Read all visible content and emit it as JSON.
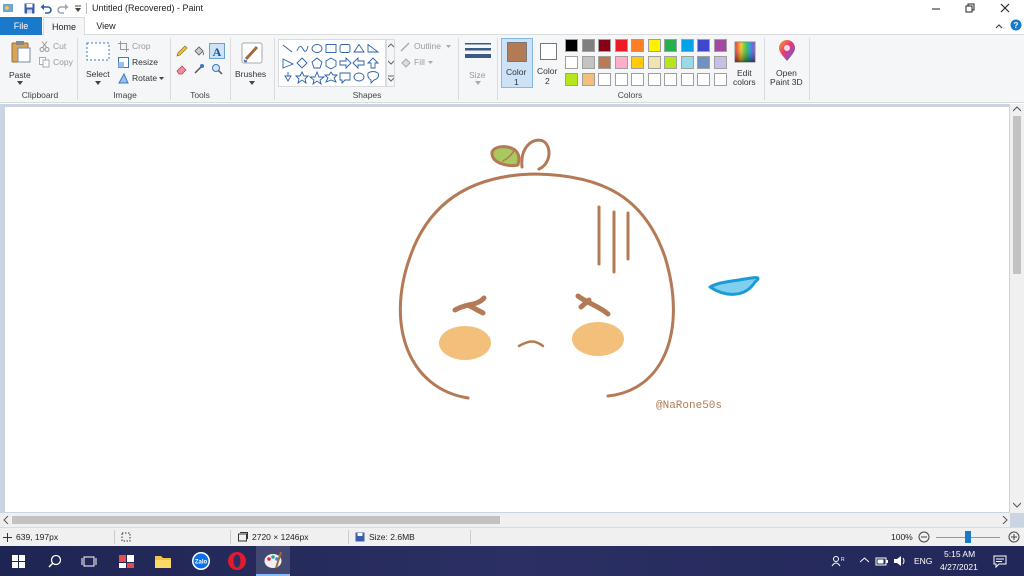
{
  "window": {
    "title": "Untitled (Recovered) - Paint"
  },
  "tabs": {
    "file": "File",
    "home": "Home",
    "view": "View"
  },
  "clipboard": {
    "paste": "Paste",
    "cut": "Cut",
    "copy": "Copy",
    "group": "Clipboard"
  },
  "image": {
    "select": "Select",
    "crop": "Crop",
    "resize": "Resize",
    "rotate": "Rotate",
    "group": "Image"
  },
  "tools": {
    "group": "Tools"
  },
  "brushes": {
    "label": "Brushes"
  },
  "shapes": {
    "outline": "Outline",
    "fill": "Fill",
    "group": "Shapes"
  },
  "size": {
    "label": "Size"
  },
  "colors": {
    "color1": "Color",
    "color1_num": "1",
    "color2": "Color",
    "color2_num": "2",
    "edit1": "Edit",
    "edit2": "colors",
    "group": "Colors",
    "color1_value": "#b47a55",
    "color2_value": "#ffffff",
    "row1": [
      "#000000",
      "#7f7f7f",
      "#880015",
      "#ed1c24",
      "#ff7f27",
      "#fff200",
      "#22b14c",
      "#00a2e8",
      "#3f48cc",
      "#a349a4"
    ],
    "row2": [
      "#ffffff",
      "#c3c3c3",
      "#b97a57",
      "#ffaec9",
      "#ffc90e",
      "#efe4b0",
      "#b5e61d",
      "#99d9ea",
      "#7092be",
      "#c8bfe7"
    ],
    "row3": [
      "#b5e61d",
      "#f2c07a",
      "#ffffff",
      "#ffffff",
      "#ffffff",
      "#ffffff",
      "#ffffff",
      "#ffffff",
      "#ffffff",
      "#ffffff"
    ]
  },
  "paint3d": {
    "l1": "Open",
    "l2": "Paint 3D"
  },
  "drawing": {
    "watermark": "@NaRone50s",
    "stroke_color": "#b47a55",
    "blush_color": "#f2c07a",
    "leaf_color": "#a7c960",
    "drop_color": "#7fcfee",
    "drop_stroke": "#1a9ad6"
  },
  "status": {
    "cursor": "639, 197px",
    "dimensions": "2720 × 1246px",
    "filesize": "Size: 2.6MB",
    "zoom": "100%",
    "zoom_level": 100
  },
  "taskbar": {
    "lang": "ENG",
    "time": "5:15 AM",
    "date": "4/27/2021",
    "zalo": "Zalo"
  }
}
